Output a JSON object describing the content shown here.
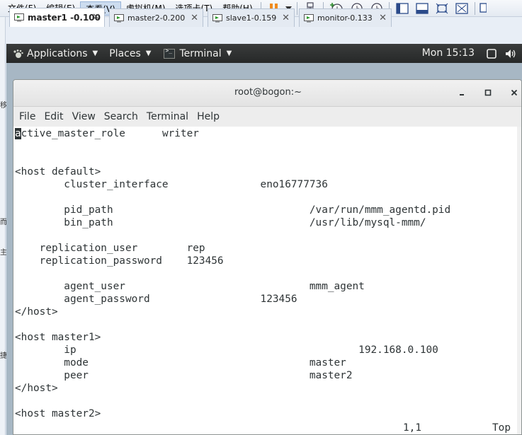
{
  "vm": {
    "menu": [
      {
        "label": "文件(F)",
        "name": "file"
      },
      {
        "label": "编辑(E)",
        "name": "edit"
      },
      {
        "label": "查看(V)",
        "name": "view",
        "active": true
      },
      {
        "label": "虚拟机(M)",
        "name": "vm"
      },
      {
        "label": "选项卡(T)",
        "name": "tabs"
      },
      {
        "label": "帮助(H)",
        "name": "help"
      }
    ],
    "tabs": [
      {
        "label": "master1 -0.100",
        "active": true
      },
      {
        "label": "master2-0.200"
      },
      {
        "label": "slave1-0.159"
      },
      {
        "label": "monitor-0.133"
      }
    ],
    "tab_close_glyph": "✕"
  },
  "gnome": {
    "applications": "Applications",
    "places": "Places",
    "terminal": "Terminal",
    "clock": "Mon 15:13"
  },
  "terminal": {
    "title": "root@bogon:~",
    "menu": [
      "File",
      "Edit",
      "View",
      "Search",
      "Terminal",
      "Help"
    ],
    "cursor_char": "a",
    "lines": [
      "ctive_master_role      writer",
      "",
      "",
      "<host default>",
      "        cluster_interface               eno16777736",
      "",
      "        pid_path                                /var/run/mmm_agentd.pid",
      "        bin_path                                /usr/lib/mysql-mmm/",
      "",
      "    replication_user        rep",
      "    replication_password    123456",
      "",
      "        agent_user                              mmm_agent",
      "        agent_password                  123456",
      "</host>",
      "",
      "<host master1>",
      "        ip                                              192.168.0.100",
      "        mode                                    master",
      "        peer                                    master2",
      "</host>",
      "",
      "<host master2>"
    ],
    "status_position": "1,1",
    "status_scroll": "Top"
  },
  "colors": {
    "gnome_bar": "#2c2e2e",
    "desktop": "#a7b7c4",
    "terminal_fg": "#2e3436",
    "vm_active_menu": "#ccdcef"
  }
}
